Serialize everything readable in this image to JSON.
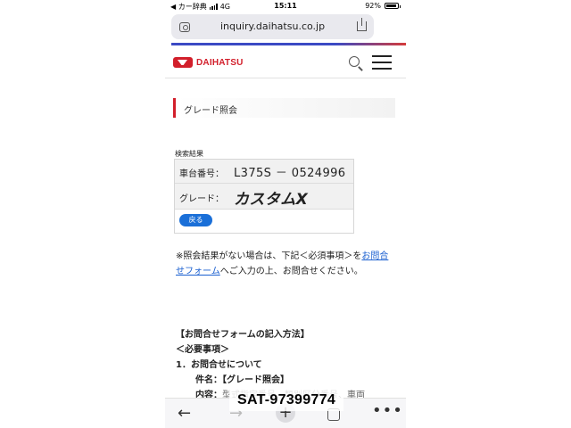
{
  "status_bar": {
    "carrier": "◀ カー辞典",
    "network": "4G",
    "time": "15:11",
    "battery_percent": "92%",
    "battery_level": 0.92
  },
  "browser": {
    "url": "inquiry.daihatsu.co.jp",
    "reader_icon": "reader-mode-icon",
    "share_icon": "share-icon"
  },
  "site": {
    "brand": "DAIHATSU",
    "logo_icon": "daihatsu-logo-icon",
    "search_icon": "search-icon",
    "menu_icon": "hamburger-menu-icon",
    "brand_color": "#d21f2b"
  },
  "page": {
    "section_title": "グレード照会",
    "results_label": "検索結果",
    "results": {
      "chassis_label": "車台番号：",
      "chassis_value": "L375S － 0524996",
      "grade_label": "グレード：",
      "grade_value": "カスタムX"
    },
    "back_button": "戻る",
    "note_prefix": "※照会結果がない場合は、下記＜必須事項＞を",
    "note_link": "お問合せフォーム",
    "note_suffix": "へご入力の上、お問合せください。",
    "howto_title": "【お問合せフォームの記入方法】",
    "required_title": "＜必要事項＞",
    "item_1": "1．お問合せについて",
    "subject_line": "件名：【グレード照会】",
    "content_line_label": "内容：",
    "content_line_text": "型式指定番号、類別区分番号、車両"
  },
  "bottom_bar": {
    "back_icon": "arrow-left-icon",
    "forward_icon": "arrow-right-icon",
    "new_tab_icon": "plus-icon",
    "tabs_icon": "tabs-icon",
    "more_icon": "more-icon"
  },
  "watermark": "SAT-97399774"
}
